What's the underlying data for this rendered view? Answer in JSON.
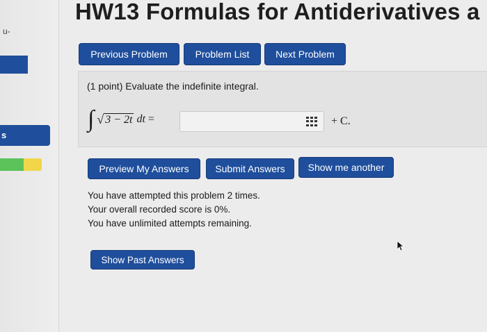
{
  "sidebar": {
    "top_text": "u-",
    "item_label": "s"
  },
  "page_title": "HW13 Formulas for Antiderivatives a",
  "nav": {
    "previous": "Previous Problem",
    "list": "Problem List",
    "next": "Next Problem"
  },
  "problem": {
    "statement": "(1 point) Evaluate the indefinite integral.",
    "radicand": "3 − 2t",
    "differential": "dt",
    "equals": "=",
    "answer_value": "",
    "constant": "+ C."
  },
  "actions": {
    "preview": "Preview My Answers",
    "submit": "Submit Answers",
    "another": "Show me another"
  },
  "status": {
    "attempts": "You have attempted this problem 2 times.",
    "score": "Your overall recorded score is 0%.",
    "remaining": "You have unlimited attempts remaining."
  },
  "past_answers": "Show Past Answers",
  "icons": {
    "integral": "∫",
    "sqrt": "√",
    "equation_editor": "grid-icon",
    "cursor": "mouse-pointer-icon"
  },
  "colors": {
    "button": "#1f4e9c",
    "progress_done": "#5cc35a",
    "progress_partial": "#f1d64a"
  }
}
